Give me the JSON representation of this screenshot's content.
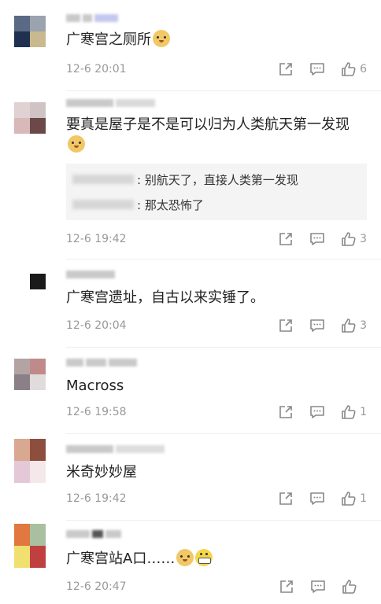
{
  "comments": [
    {
      "avatar_colors": [
        "#5a6a84",
        "#9aa3ae",
        "#1f3050",
        "#c9b98f"
      ],
      "username_colors": [
        "#b8b8b8",
        "#8a8a8a",
        "#c4c8f0"
      ],
      "text": "广寒宫之厕所",
      "emojis": [
        "doge-emoji"
      ],
      "time": "12-6 20:01",
      "like_count": "6"
    },
    {
      "avatar_colors": [
        "#e0d2d2",
        "#cfc3c3",
        "#d8b8b8",
        "#6c4848"
      ],
      "username_colors": [
        "#cccccc",
        "#d8d8d8"
      ],
      "text": "要真是屋子是不是可以归为人类航天第一发现",
      "emojis": [
        "doge-emoji"
      ],
      "replies": [
        {
          "text": ": 别航天了，直接人类第一发现"
        },
        {
          "text": ": 那太恐怖了"
        }
      ],
      "time": "12-6 19:42",
      "like_count": "3"
    },
    {
      "avatar_colors": [
        "#ffffff",
        "#1a1a1a",
        "#ffffff",
        "#ffffff"
      ],
      "username_colors": [
        "#c8c8c8"
      ],
      "text": "广寒宫遗址，自古以来实锤了。",
      "emojis": [],
      "time": "12-6 20:04",
      "like_count": "3"
    },
    {
      "avatar_colors": [
        "#b4a3a3",
        "#c18a8a",
        "#8c8088",
        "#e0dcdc"
      ],
      "username_colors": [
        "#aaaaaa",
        "#bbbbbb",
        "#999999"
      ],
      "text": "Macross",
      "emojis": [],
      "time": "12-6 19:58",
      "like_count": "1"
    },
    {
      "avatar_colors": [
        "#d8a890",
        "#8e4e3e",
        "#e4c8d8",
        "#f4e8e8"
      ],
      "username_colors": [
        "#c8c8c8",
        "#dddddd"
      ],
      "text": "米奇妙妙屋",
      "emojis": [],
      "time": "12-6 19:42",
      "like_count": "1"
    },
    {
      "avatar_colors": [
        "#e07840",
        "#a8c0a0",
        "#f0e070",
        "#c04040"
      ],
      "username_colors": [
        "#bbbbbb",
        "#555555"
      ],
      "text": "广寒宫站A口……",
      "emojis": [
        "doge-emoji",
        "grin-emoji"
      ],
      "time": "12-6 20:47",
      "like_count": ""
    }
  ],
  "icons": {
    "share": "share-icon",
    "comment": "comment-icon",
    "like": "thumbs-up-icon"
  },
  "colors": {
    "time": "#999999",
    "text": "#222222",
    "reply_bg": "#f4f4f4"
  }
}
